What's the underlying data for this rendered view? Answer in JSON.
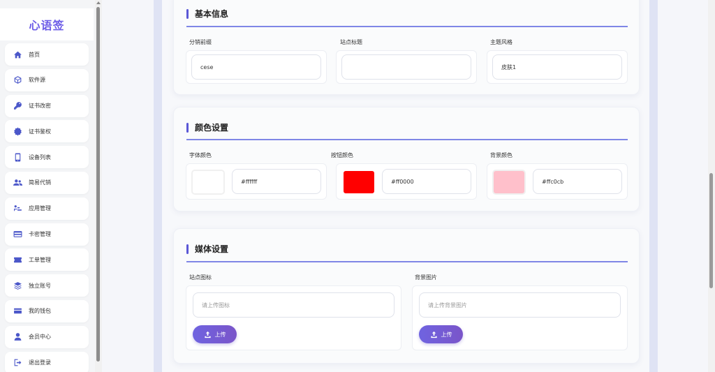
{
  "brand": {
    "title": "心语签"
  },
  "sidebar": {
    "items": [
      {
        "label": "首页",
        "icon": "home-icon"
      },
      {
        "label": "软件源",
        "icon": "box-icon"
      },
      {
        "label": "证书改密",
        "icon": "key-icon"
      },
      {
        "label": "证书鉴权",
        "icon": "gear-icon"
      },
      {
        "label": "设备列表",
        "icon": "phone-icon"
      },
      {
        "label": "简易代销",
        "icon": "users-icon"
      },
      {
        "label": "应用管理",
        "icon": "apps-icon"
      },
      {
        "label": "卡密管理",
        "icon": "card-icon"
      },
      {
        "label": "工单管理",
        "icon": "ticket-icon"
      },
      {
        "label": "独立账号",
        "icon": "layers-icon"
      },
      {
        "label": "我的钱包",
        "icon": "wallet-icon"
      },
      {
        "label": "会员中心",
        "icon": "user-icon"
      },
      {
        "label": "退出登录",
        "icon": "logout-icon"
      }
    ]
  },
  "basic": {
    "title": "基本信息",
    "fields": [
      {
        "label": "分销前缀",
        "value": "cese"
      },
      {
        "label": "站点标题",
        "value": ""
      },
      {
        "label": "主题风格",
        "value": "皮肤1"
      }
    ]
  },
  "colors": {
    "title": "颜色设置",
    "fields": [
      {
        "label": "字体颜色",
        "value": "#ffffff",
        "swatch": "#ffffff"
      },
      {
        "label": "按钮颜色",
        "value": "#ff0000",
        "swatch": "#ff0000"
      },
      {
        "label": "背景颜色",
        "value": "#ffc0cb",
        "swatch": "#ffc0cb"
      }
    ]
  },
  "media": {
    "title": "媒体设置",
    "fields": [
      {
        "label": "站点图标",
        "placeholder": "请上传图标",
        "button": "上传"
      },
      {
        "label": "背景图片",
        "placeholder": "请上传背景图片",
        "button": "上传"
      }
    ]
  },
  "theme": {
    "accent": "#5a57d6",
    "brand": "#6c5ce7"
  }
}
